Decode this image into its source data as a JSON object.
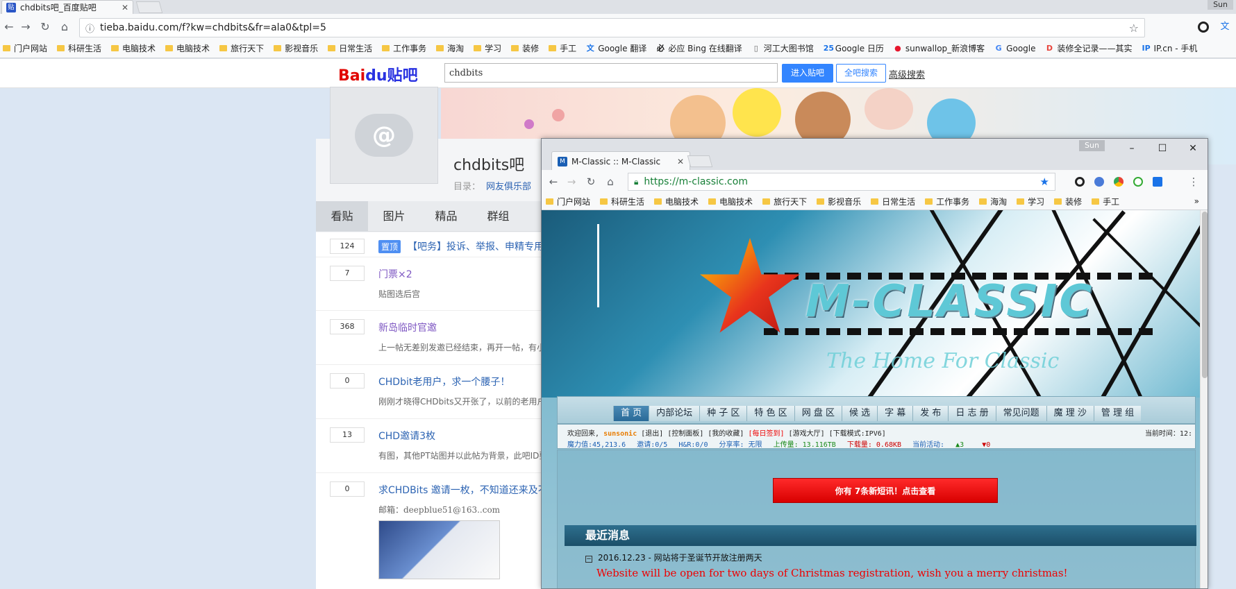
{
  "outer_browser": {
    "tab_title": "chdbits吧_百度贴吧",
    "favicon": "贴",
    "user_badge": "Sun",
    "url": "tieba.baidu.com/f?kw=chdbits&fr=ala0&tpl=5",
    "bookmarks": [
      {
        "label": "门户网站",
        "icon": "folder"
      },
      {
        "label": "科研生活",
        "icon": "folder"
      },
      {
        "label": "电脑技术",
        "icon": "folder"
      },
      {
        "label": "电脑技术",
        "icon": "folder"
      },
      {
        "label": "旅行天下",
        "icon": "folder"
      },
      {
        "label": "影视音乐",
        "icon": "folder"
      },
      {
        "label": "日常生活",
        "icon": "folder"
      },
      {
        "label": "工作事务",
        "icon": "folder"
      },
      {
        "label": "海淘",
        "icon": "folder"
      },
      {
        "label": "学习",
        "icon": "folder"
      },
      {
        "label": "装修",
        "icon": "folder"
      },
      {
        "label": "手工",
        "icon": "folder"
      },
      {
        "label": "Google 翻译",
        "icon": "translate"
      },
      {
        "label": "必应 Bing 在线翻译",
        "icon": "bing"
      },
      {
        "label": "河工大图书馆",
        "icon": "page"
      },
      {
        "label": "Google 日历",
        "icon": "calendar"
      },
      {
        "label": "sunwallop_新浪博客",
        "icon": "weibo"
      },
      {
        "label": "Google",
        "icon": "google"
      },
      {
        "label": "装修全记录——其实",
        "icon": "d"
      },
      {
        "label": "IP.cn - 手机",
        "icon": "ip"
      }
    ]
  },
  "tieba": {
    "logo_part1": "Bai",
    "logo_part2": "du贴吧",
    "search_value": "chdbits",
    "enter_button": "进入贴吧",
    "all_search_button": "全吧搜索",
    "advanced_search": "高级搜索",
    "avatar_glyph": "@",
    "forum_name": "chdbits吧",
    "dir_label": "目录：",
    "dir_link": "网友俱乐部",
    "tabs": [
      "看贴",
      "图片",
      "精品",
      "群组"
    ],
    "threads": [
      {
        "count": "124",
        "pin": "置顶",
        "title": "【吧务】投诉、举报、申精专用",
        "sub": ""
      },
      {
        "count": "7",
        "title": "门票×2",
        "sub": "贴图选后宫"
      },
      {
        "count": "368",
        "title": "新岛临时官邀",
        "sub": "上一帖无差别发邀已经结束，再开一帖，有小"
      },
      {
        "count": "0",
        "title": "CHDbit老用户，求一个腰子！",
        "sub": "刚刚才晓得CHDbits又开张了，以前的老用户"
      },
      {
        "count": "13",
        "title": "CHD邀请3枚",
        "sub": "有图，其他PT站图并以此帖为背景，此吧ID要"
      },
      {
        "count": "0",
        "title": "求CHDBits 邀请一枚，不知道还来及不",
        "sub": "邮箱：deepblue51@163..com"
      }
    ]
  },
  "inner_browser": {
    "user_badge": "Sun",
    "tab_title": "M-Classic :: M-Classic",
    "url": "https://m-classic.com",
    "bookmarks": [
      "门户网站",
      "科研生活",
      "电脑技术",
      "电脑技术",
      "旅行天下",
      "影视音乐",
      "日常生活",
      "工作事务",
      "海淘",
      "学习",
      "装修",
      "手工"
    ],
    "more": "»"
  },
  "mclassic": {
    "logo_text": "M-CLASSIC",
    "slogan": "The Home For Classic",
    "nav": [
      "首 页",
      "内部论坛",
      "种 子 区",
      "特 色 区",
      "网 盘 区",
      "候 选",
      "字 幕",
      "发 布",
      "日 志 册",
      "常见问题",
      "魔 理 沙",
      "管 理 组"
    ],
    "welcome": "欢迎回来,",
    "username": "sunsonic",
    "links": "[退出] [控制面板] [我的收藏]",
    "signin": "[每日签到]",
    "links2": "[游戏大厅] [下载模式:IPV6]",
    "current_time": "当前时间：12:",
    "stats": {
      "magic": "魔力值:45,213.6",
      "invite": "邀请:0/5",
      "hr": "H&R:0/0",
      "ratio": "分享率: 无限",
      "upload": "上传量: 13.116TB",
      "download": "下载量: 0.68KB",
      "activity": "当前活动:",
      "seeding": "3",
      "leeching": "0"
    },
    "new_message": "你有 7条新短讯！点击查看",
    "news_title": "最近消息",
    "news_item": "2016.12.23 - 网站将于圣诞节开放注册两天",
    "news_body": "Website will be open for two days of Christmas registration, wish you a merry christmas!"
  }
}
